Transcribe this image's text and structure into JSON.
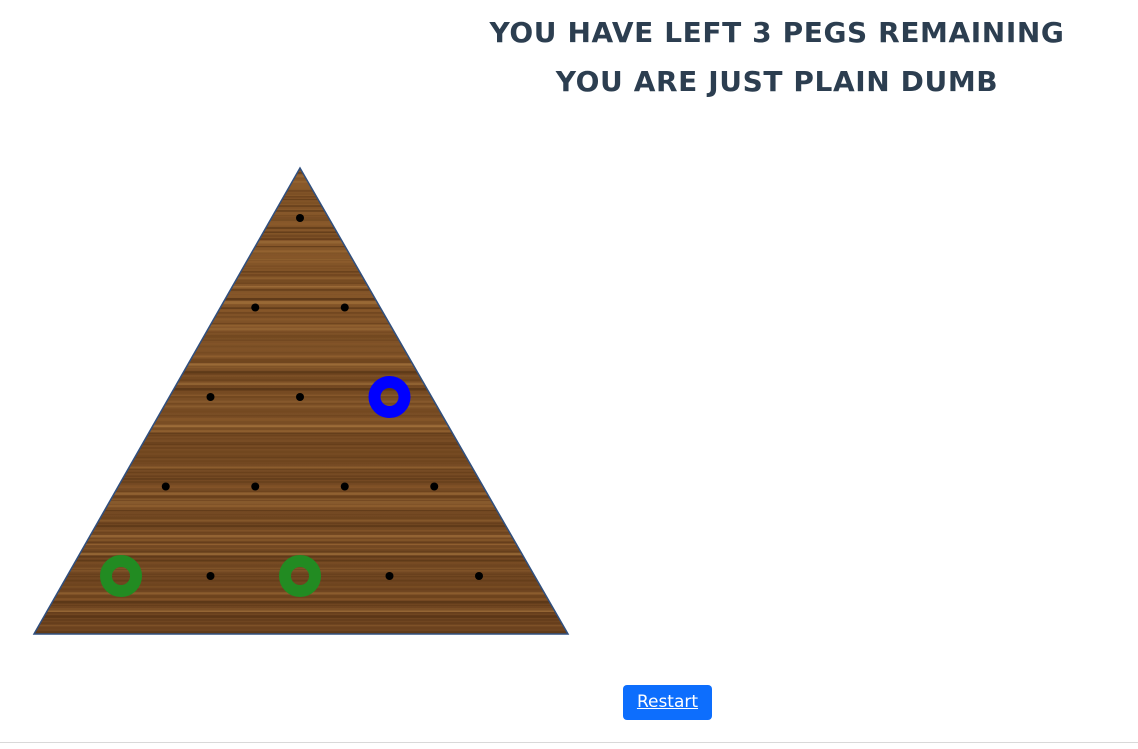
{
  "status": {
    "line1": "YOU HAVE LEFT 3 PEGS REMAINING",
    "line2": "YOU ARE JUST PLAIN DUMB"
  },
  "controls": {
    "restart_label": "Restart"
  },
  "board": {
    "rows": 5,
    "pegs": [
      {
        "row": 3,
        "col": 3,
        "color": "#0000ff"
      },
      {
        "row": 5,
        "col": 1,
        "color": "#228b22"
      },
      {
        "row": 5,
        "col": 3,
        "color": "#228b22"
      }
    ],
    "empty_hole_color": "#000000",
    "edge_color": "#2f4f7f"
  }
}
